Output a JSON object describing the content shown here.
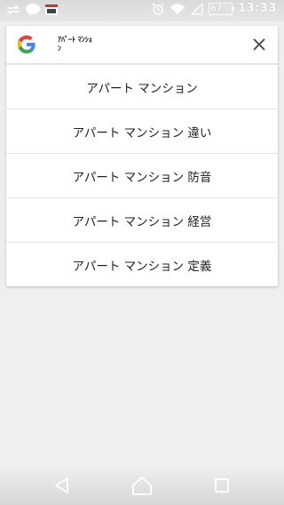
{
  "status_bar": {
    "time": "13:33",
    "battery": "67%",
    "icons": [
      "transfer-icon",
      "line-app-icon",
      "mail-app-icon",
      "alarm-icon",
      "wifi-icon",
      "signal-icon",
      "battery-icon"
    ]
  },
  "search": {
    "query": "ｱﾊﾟｰﾄ ﾏﾝｼｮﾝ",
    "logo": "google-g-logo",
    "clear_icon": "close-icon"
  },
  "suggestions": [
    "アパート マンション",
    "アパート マンション 違い",
    "アパート マンション 防音",
    "アパート マンション 経営",
    "アパート マンション 定義"
  ],
  "nav": {
    "back_icon": "back-icon",
    "home_icon": "home-icon",
    "recents_icon": "recents-icon"
  },
  "colors": {
    "background": "#efefef",
    "card": "#ffffff",
    "google_blue": "#4285F4",
    "google_red": "#EA4335",
    "google_yellow": "#FBBC05",
    "google_green": "#34A853"
  }
}
